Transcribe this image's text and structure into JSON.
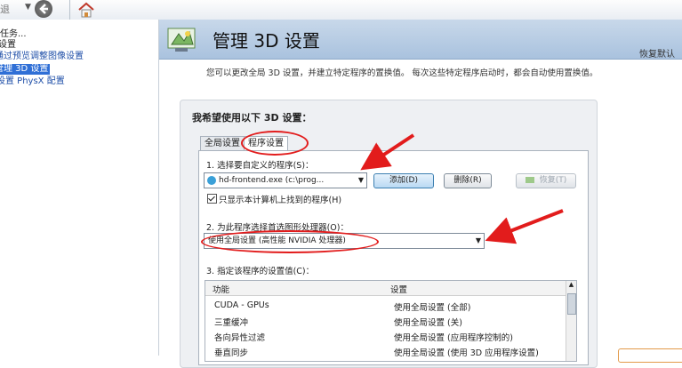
{
  "toolbar": {
    "nav_text": "退",
    "back_icon": "back-icon",
    "home_icon": "home-icon"
  },
  "left_pane": {
    "task_header": "任务...",
    "items": [
      {
        "label": "设置",
        "state": "normal"
      },
      {
        "label": "通过预览调整图像设置",
        "state": "link"
      },
      {
        "label": "管理 3D 设置",
        "state": "selected"
      },
      {
        "label": "设置 PhysX 配置",
        "state": "link"
      }
    ]
  },
  "header": {
    "title": "管理 3D 设置",
    "restore_label": "恢复默认"
  },
  "description": "您可以更改全局 3D 设置，并建立特定程序的置换值。 每次这些特定程序启动时，都会自动使用置换值。",
  "section_title": "我希望使用以下 3D 设置：",
  "tabs": [
    {
      "label": "全局设置"
    },
    {
      "label": "程序设置"
    }
  ],
  "step1": {
    "label": "1. 选择要自定义的程序(S)：",
    "program_value": "hd-frontend.exe (c:\\prog...",
    "add_button": "添加(D)",
    "remove_button": "删除(R)",
    "restore_button": "恢复(T)",
    "checkbox_label": "只显示本计算机上找到的程序(H)",
    "checkbox_checked": true
  },
  "step2": {
    "label": "2. 为此程序选择首选图形处理器(O)：",
    "gpu_value": "使用全局设置 (高性能 NVIDIA 处理器)"
  },
  "step3": {
    "label": "3. 指定该程序的设置值(C)：",
    "columns": [
      "功能",
      "设置"
    ],
    "rows": [
      {
        "feature": "CUDA - GPUs",
        "setting": "使用全局设置 (全部)"
      },
      {
        "feature": "三重缓冲",
        "setting": "使用全局设置 (关)"
      },
      {
        "feature": "各向异性过滤",
        "setting": "使用全局设置 (应用程序控制的)"
      },
      {
        "feature": "垂直同步",
        "setting": "使用全局设置 (使用 3D 应用程序设置)"
      }
    ]
  },
  "colors": {
    "annotation": "#e21c1c",
    "selection": "#2f6fd6",
    "header_bg": "#b8cde4"
  }
}
